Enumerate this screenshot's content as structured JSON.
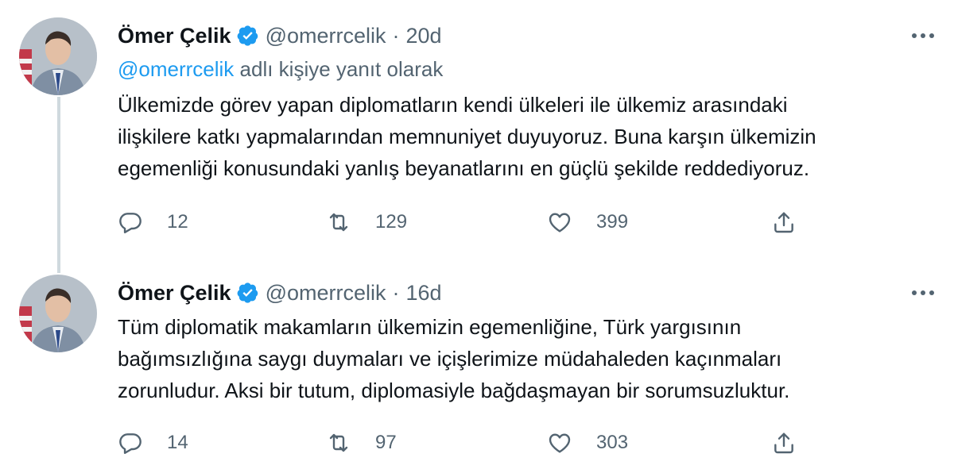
{
  "colors": {
    "accent": "#1d9bf0",
    "text": "#0f1419",
    "muted": "#536471",
    "thread_line": "#cfd9de"
  },
  "tweets": [
    {
      "author_name": "Ömer Çelik",
      "handle": "@omerrcelik",
      "separator": "·",
      "time": "20d",
      "reply_mention": "@omerrcelik",
      "reply_suffix": " adlı kişiye yanıt olarak",
      "body": "Ülkemizde görev yapan diplomatların kendi ülkeleri ile ülkemiz arasındaki\nilişkilere katkı yapmalarından memnuniyet duyuyoruz. Buna karşın ülkemizin\negemenliği konusundaki yanlış beyanatlarını en güçlü şekilde reddediyoruz.",
      "replies": "12",
      "retweets": "129",
      "likes": "399",
      "icons": [
        "verified-badge-icon",
        "more-icon",
        "reply-icon",
        "retweet-icon",
        "like-icon",
        "share-icon"
      ]
    },
    {
      "author_name": "Ömer Çelik",
      "handle": "@omerrcelik",
      "separator": "·",
      "time": "16d",
      "body": "Tüm diplomatik makamların ülkemizin egemenliğine, Türk yargısının\nbağımsızlığına saygı duymaları ve içişlerimize müdahaleden kaçınmaları\nzorunludur. Aksi bir tutum, diplomasiyle bağdaşmayan bir sorumsuzluktur.",
      "replies": "14",
      "retweets": "97",
      "likes": "303",
      "icons": [
        "verified-badge-icon",
        "more-icon",
        "reply-icon",
        "retweet-icon",
        "like-icon",
        "share-icon"
      ]
    }
  ]
}
